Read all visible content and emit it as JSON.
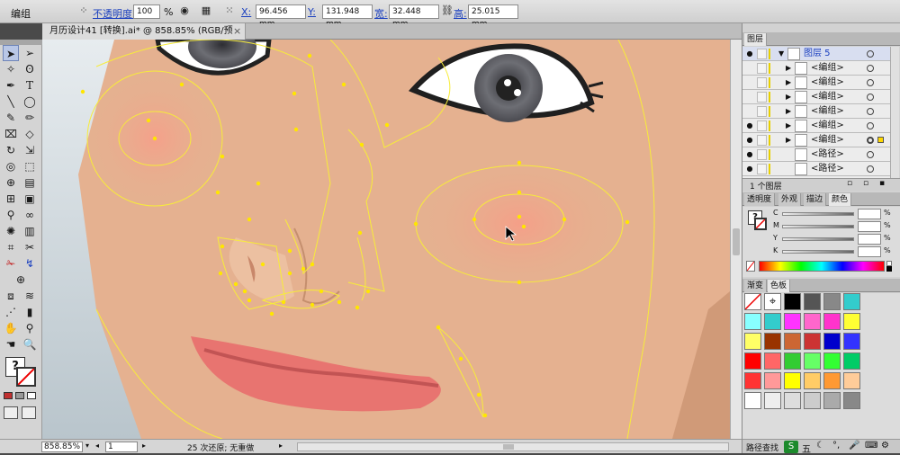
{
  "control_bar": {
    "group_label": "编组",
    "opacity_label": "不透明度:",
    "opacity_value": "100",
    "opacity_unit": "%",
    "x_label": "X:",
    "x_value": "96.456 mm",
    "y_label": "Y:",
    "y_value": "131.948 mm",
    "w_label": "宽:",
    "w_value": "32.448 mm",
    "h_label": "高:",
    "h_value": "25.015 mm"
  },
  "document_tab": {
    "title": "月历设计41 [转换].ai* @ 858.85% (RGB/预览)",
    "close": "×"
  },
  "status_bar": {
    "zoom": "858.85%",
    "page": "1",
    "status_text": "25 次还原; 无重做"
  },
  "layers_panel": {
    "tab_label": "图层",
    "rows": [
      {
        "name": "图层 5",
        "selected": true
      },
      {
        "name": "<编组>"
      },
      {
        "name": "<编组>"
      },
      {
        "name": "<编组>"
      },
      {
        "name": "<编组>"
      },
      {
        "name": "<编组>"
      },
      {
        "name": "<编组>"
      },
      {
        "name": "<路径>"
      },
      {
        "name": "<路径>"
      }
    ],
    "footer_count": "1 个图层"
  },
  "color_panel": {
    "tabs": [
      "透明度",
      "外观",
      "描边",
      "颜色"
    ],
    "channels": [
      "C",
      "M",
      "Y",
      "K"
    ],
    "unit": "%"
  },
  "swatch_panel": {
    "tabs": [
      "渐变",
      "色板"
    ],
    "colors": [
      "#ffffff",
      "#ffffff",
      "#000000",
      "#555555",
      "#888888",
      "#33cccc",
      "#88ffff",
      "#33cccc",
      "#ff33ff",
      "#ff66cc",
      "#ff33cc",
      "#ffff33",
      "#ffff66",
      "#993300",
      "#cc6633",
      "#cc3333",
      "#0000cc",
      "#3333ff",
      "#ff0000",
      "#ff6666",
      "#33cc33",
      "#66ff66",
      "#33ff33",
      "#00cc66",
      "#ff3333",
      "#ff9999",
      "#ffff00",
      "#ffcc66",
      "#ff9933",
      "#ffcc99",
      "#ffffff",
      "#eeeeee",
      "#dddddd",
      "#cccccc",
      "#aaaaaa",
      "#888888"
    ],
    "footer_label": "路径查找"
  },
  "taskbar": {
    "ime_label": "五"
  },
  "colors": {
    "skin": "#e5b190",
    "outline": "#f7ec3a",
    "anchor": "#ffe600",
    "lip": "#e87470",
    "cheek": "#f4a38c"
  }
}
